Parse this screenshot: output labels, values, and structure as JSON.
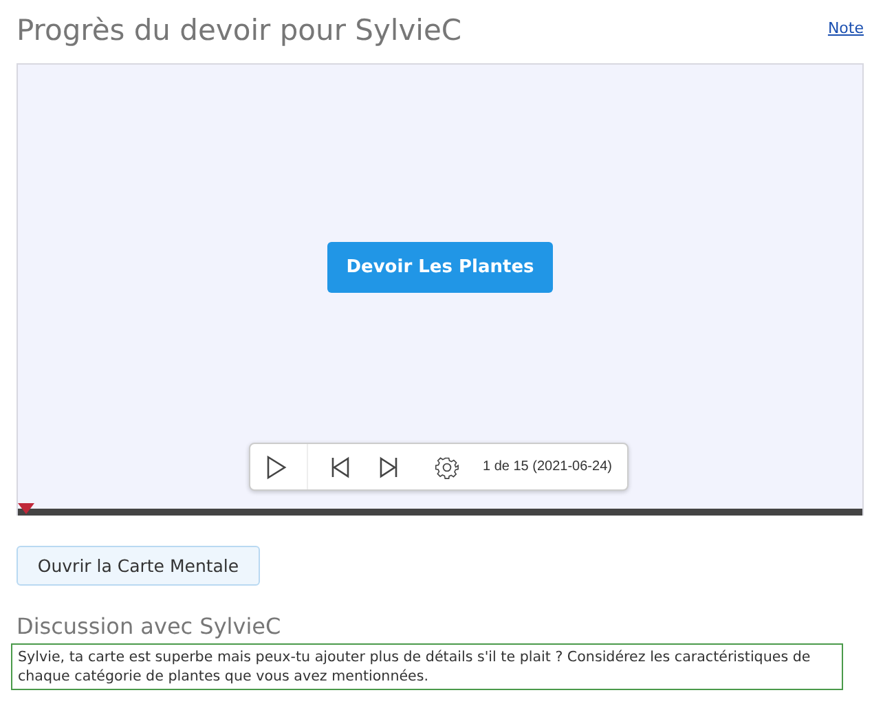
{
  "header": {
    "title": "Progrès du devoir pour SylvieC",
    "link": "Note"
  },
  "player": {
    "slide_button": "Devoir Les Plantes",
    "counter": "1 de 15 (2021-06-24)",
    "progress": {
      "level": 0
    }
  },
  "open_button": "Ouvrir la Carte Mentale",
  "discussion": {
    "title": "Discussion avec SylvieC",
    "comment": "Sylvie, ta carte est superbe mais peux-tu ajouter plus de détails s'il te plait ? Considérez les caractéristiques de chaque catégorie de plantes que vous avez mentionnées."
  }
}
